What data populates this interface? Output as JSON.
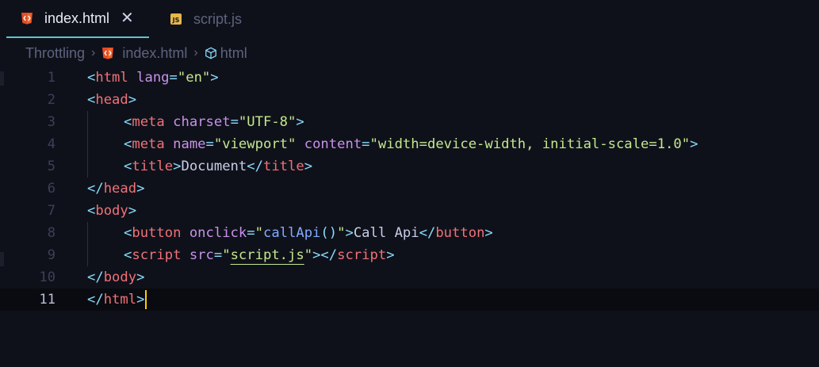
{
  "tabs": [
    {
      "label": "index.html",
      "icon": "html5-icon",
      "active": true,
      "close": "✕"
    },
    {
      "label": "script.js",
      "icon": "js-file-icon",
      "active": false,
      "icon_text": "JS"
    }
  ],
  "breadcrumb": {
    "folder": "Throttling",
    "file": "index.html",
    "symbol": "html",
    "sep": "›"
  },
  "editor": {
    "current_line": 11,
    "lines": [
      {
        "n": "1"
      },
      {
        "n": "2"
      },
      {
        "n": "3"
      },
      {
        "n": "4"
      },
      {
        "n": "5"
      },
      {
        "n": "6"
      },
      {
        "n": "7"
      },
      {
        "n": "8"
      },
      {
        "n": "9"
      },
      {
        "n": "10"
      },
      {
        "n": "11"
      }
    ],
    "tokens": {
      "html": "html",
      "lang_attr": "lang",
      "lang_val": "\"en\"",
      "head": "head",
      "meta": "meta",
      "charset_attr": "charset",
      "charset_val": "\"UTF-8\"",
      "name_attr": "name",
      "name_val": "\"viewport\"",
      "content_attr": "content",
      "content_val": "\"width=device-width, initial-scale=1.0\"",
      "title": "title",
      "title_text": "Document",
      "body": "body",
      "button": "button",
      "onclick_attr": "onclick",
      "onclick_q1": "\"",
      "onclick_fn": "callApi",
      "onclick_parens": "()",
      "onclick_q2": "\"",
      "button_text": "Call Api",
      "script": "script",
      "src_attr": "src",
      "src_q1": "\"",
      "src_val": "script.js",
      "src_q2": "\""
    }
  },
  "colors": {
    "background": "#0f111a",
    "tag": "#f07178",
    "punctuation": "#89ddff",
    "attribute": "#c792ea",
    "string": "#c3e88d",
    "function": "#82aaff",
    "active_tab_underline": "#5ec4cf",
    "cursor": "#ffcc00"
  }
}
